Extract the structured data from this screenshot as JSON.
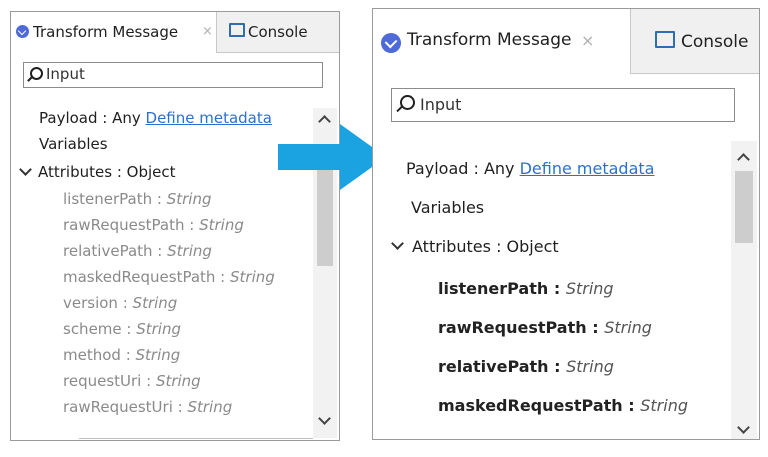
{
  "left_panel": {
    "tab_active_label": "Transform Message",
    "tab_close": "×",
    "tab_console_label": "Console",
    "search_placeholder": "Input",
    "payload_label": "Payload : Any",
    "define_metadata_link": "Define metadata",
    "variables_label": "Variables",
    "attributes_label": "Attributes : Object",
    "attributes": [
      {
        "name": "listenerPath",
        "type": "String"
      },
      {
        "name": "rawRequestPath",
        "type": "String"
      },
      {
        "name": "relativePath",
        "type": "String"
      },
      {
        "name": "maskedRequestPath",
        "type": "String"
      },
      {
        "name": "version",
        "type": "String"
      },
      {
        "name": "scheme",
        "type": "String"
      },
      {
        "name": "method",
        "type": "String"
      },
      {
        "name": "requestUri",
        "type": "String"
      },
      {
        "name": "rawRequestUri",
        "type": "String"
      }
    ]
  },
  "right_panel": {
    "tab_active_label": "Transform Message",
    "tab_close": "×",
    "tab_console_label": "Console",
    "search_placeholder": "Input",
    "payload_label": "Payload : Any",
    "define_metadata_link": "Define metadata",
    "variables_label": "Variables",
    "attributes_label": "Attributes : Object",
    "attributes": [
      {
        "name": "listenerPath",
        "type": "String"
      },
      {
        "name": "rawRequestPath",
        "type": "String"
      },
      {
        "name": "relativePath",
        "type": "String"
      },
      {
        "name": "maskedRequestPath",
        "type": "String"
      }
    ]
  },
  "type_separator": " : ",
  "colors": {
    "arrow": "#1aa3e0",
    "link": "#2d6fd0",
    "logo": "#4d6ad8",
    "console_icon": "#2f6cb0"
  }
}
